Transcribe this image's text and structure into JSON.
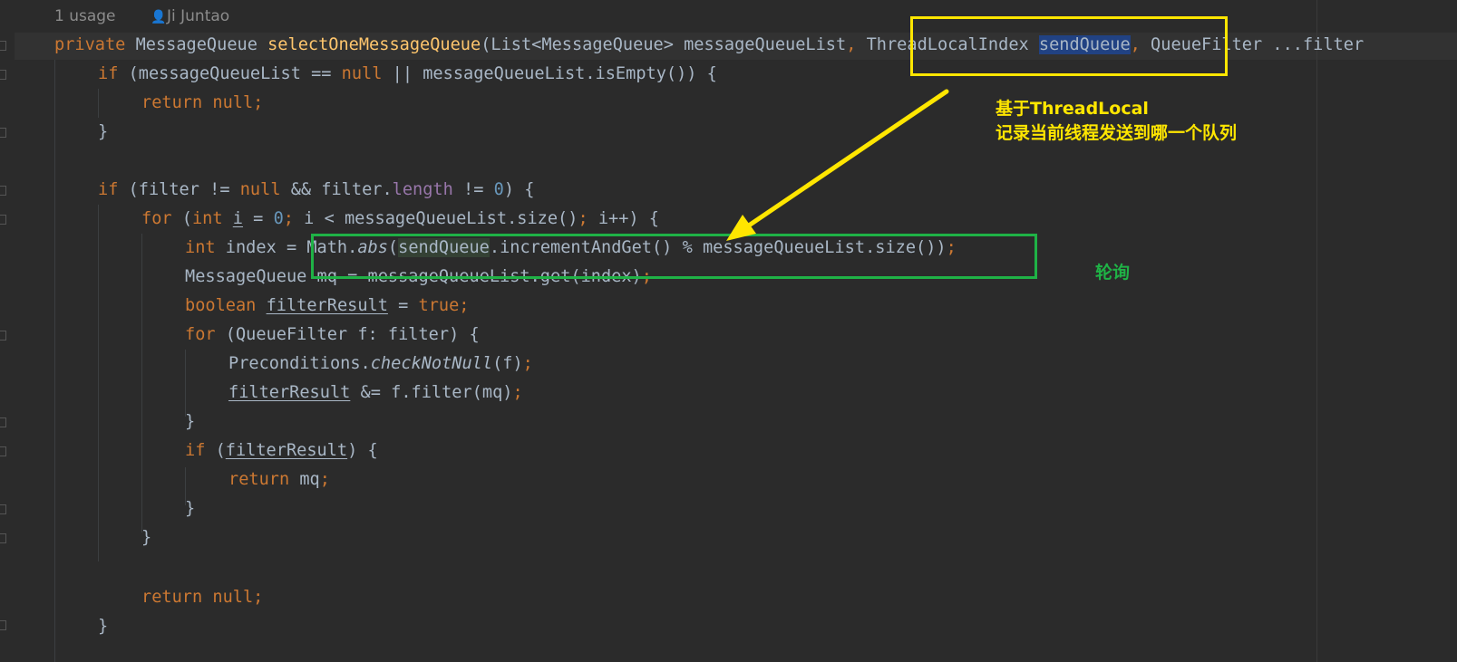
{
  "inlay_hints": {
    "usages": "1 usage",
    "author": "Ji Juntao"
  },
  "code": {
    "l1": {
      "kw_private": "private",
      "t_return_type": " MessageQueue ",
      "fn_name": "selectOneMessageQueue",
      "t_params_a": "(List<MessageQueue> messageQueueList",
      "comma1": ",",
      "t_params_b": " ThreadLocalIndex ",
      "sel_param": "sendQueue",
      "comma2": ",",
      "t_params_c": " QueueFilter ...filter"
    },
    "l2": {
      "kw_if": "if",
      "t1": " (messageQueueList == ",
      "kw_null": "null",
      "t2": " || messageQueueList.isEmpty()) {"
    },
    "l3": {
      "kw_return": "return",
      "t_sp": " ",
      "kw_null": "null",
      "semi": ";"
    },
    "l4": {
      "t": "}"
    },
    "l6": {
      "kw_if": "if",
      "t1": " (filter != ",
      "kw_null": "null",
      "t2": " && filter.",
      "field_length": "length",
      "t3": " != ",
      "num_zero": "0",
      "t4": ") {"
    },
    "l7": {
      "kw_for": "for",
      "t1": " (",
      "kw_int": "int",
      "t_sp": " ",
      "var_i": "i",
      "t2": " = ",
      "num_zero": "0",
      "semi1": ";",
      "t3": " i < messageQueueList.size()",
      "semi2": ";",
      "t4": " i++) {"
    },
    "l8": {
      "kw_int": "int",
      "t1": " index = Math.",
      "call_abs": "abs",
      "t2": "(",
      "hl_sendQueue": "sendQueue",
      "t3": ".incrementAndGet() % messageQueueList.size())",
      "semi": ";"
    },
    "l9": {
      "t": "MessageQueue mq = messageQueueList.get(index)",
      "semi": ";"
    },
    "l10": {
      "kw_boolean": "boolean",
      "t_sp": " ",
      "var_filterResult": "filterResult",
      "t1": " = ",
      "kw_true": "true",
      "semi": ";"
    },
    "l11": {
      "kw_for": "for",
      "t": " (QueueFilter f: filter) {"
    },
    "l12": {
      "t1": "Preconditions.",
      "call_check": "checkNotNull",
      "t2": "(f)",
      "semi": ";"
    },
    "l13": {
      "var_filterResult": "filterResult",
      "t1": " &= f.filter(mq)",
      "semi": ";"
    },
    "l14": {
      "t": "}"
    },
    "l15": {
      "kw_if": "if",
      "t1": " (",
      "var_filterResult": "filterResult",
      "t2": ") {"
    },
    "l16": {
      "kw_return": "return",
      "t": " mq",
      "semi": ";"
    },
    "l17": {
      "t": "}"
    },
    "l18": {
      "t": "}"
    },
    "l20": {
      "kw_return": "return",
      "t_sp": " ",
      "kw_null": "null",
      "semi": ";"
    },
    "l21": {
      "t": "}"
    }
  },
  "annotations": {
    "yellow_note_line1": "基于ThreadLocal",
    "yellow_note_line2": "记录当前线程发送到哪一个队列",
    "green_note": "轮询",
    "yellow_color": "#ffe600",
    "green_color": "#1fb246"
  },
  "theme": {
    "background": "#2b2b2b",
    "keyword": "#cc7832",
    "function": "#ffc66d",
    "number": "#6897bb",
    "field": "#9876aa",
    "text": "#a9b7c6"
  },
  "icons": {
    "author": "user-icon"
  }
}
